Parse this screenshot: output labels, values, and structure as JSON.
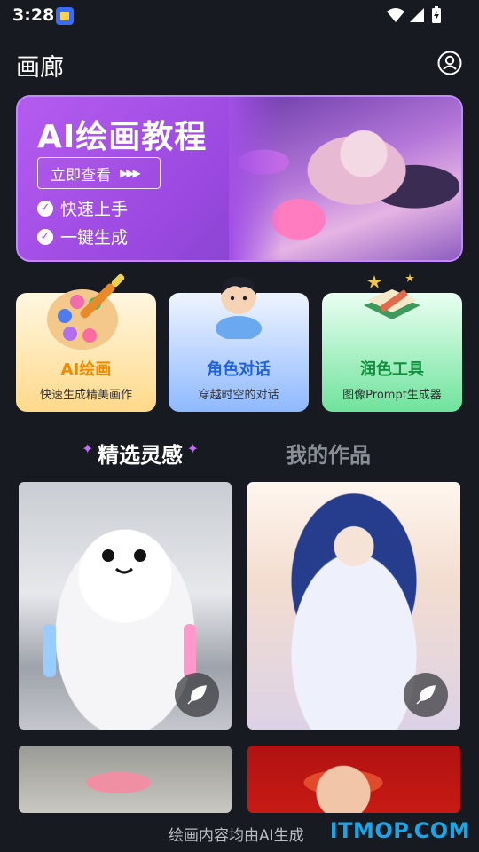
{
  "status_bar": {
    "time": "3:28"
  },
  "header": {
    "title": "画廊"
  },
  "banner": {
    "headline": "AI绘画教程",
    "cta_label": "立即查看",
    "features": [
      "快速上手",
      "一键生成"
    ]
  },
  "tools": [
    {
      "name": "AI绘画",
      "desc": "快速生成精美画作",
      "icon": "palette-icon"
    },
    {
      "name": "角色对话",
      "desc": "穿越时空的对话",
      "icon": "character-icon"
    },
    {
      "name": "润色工具",
      "desc": "图像Prompt生成器",
      "icon": "book-icon"
    }
  ],
  "tabs": {
    "active": "精选灵感",
    "inactive": "我的作品"
  },
  "footer": {
    "disclaimer": "绘画内容均由AI生成",
    "watermark": "ITMOP.COM"
  },
  "colors": {
    "background": "#171a20",
    "banner": "#a24fe6",
    "accent": "#c56bff"
  }
}
